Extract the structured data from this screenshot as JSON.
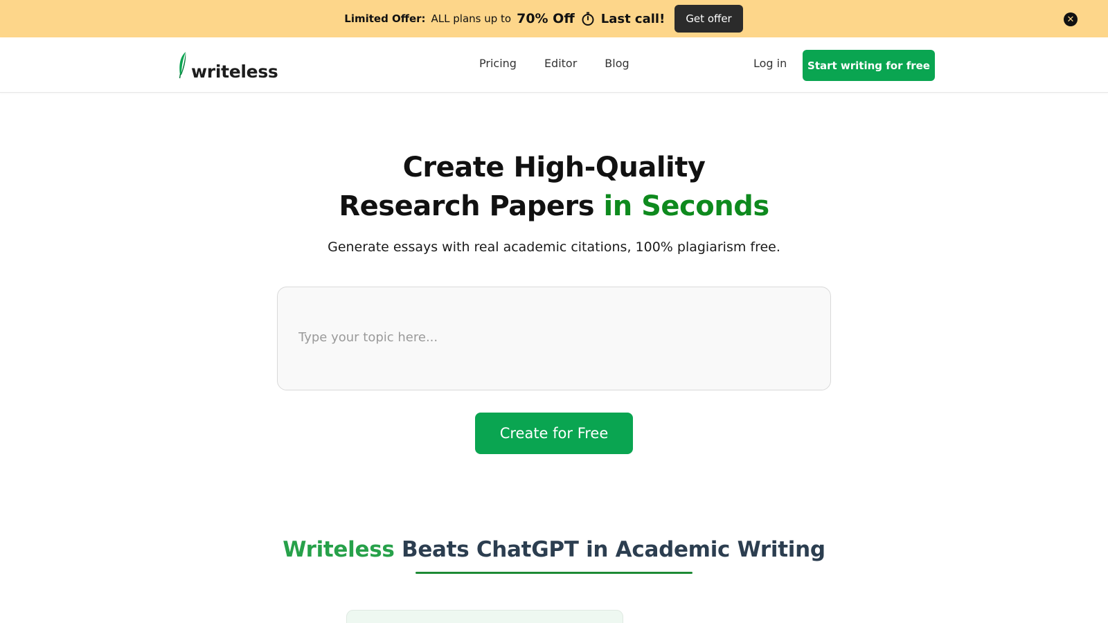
{
  "promo": {
    "label": "Limited Offer:",
    "text": "ALL plans up to",
    "highlight": "70% Off",
    "timer_icon": "stopwatch-icon",
    "last_call": "Last call!",
    "cta": "Get offer",
    "close_icon": "close-icon",
    "close_glyph": "✕",
    "background": "#fdd68a"
  },
  "header": {
    "logo_text": "writeless",
    "logo_icon": "feather-icon",
    "nav": [
      "Pricing",
      "Editor",
      "Blog"
    ],
    "login": "Log in",
    "cta": "Start writing for free"
  },
  "hero": {
    "title_line1": "Create High-Quality",
    "title_line2_main": "Research Papers",
    "title_line2_accent": "in Seconds",
    "subtitle": "Generate essays with real academic citations, 100% plagiarism free.",
    "topic_placeholder": "Type your topic here...",
    "topic_value": "",
    "create_button": "Create for Free"
  },
  "section": {
    "brand": "Writeless",
    "title_rest": "Beats ChatGPT in Academic Writing"
  },
  "colors": {
    "primary_green": "#0aa551",
    "accent_green": "#0e8a1e",
    "heading_slate": "#2c3e50"
  }
}
